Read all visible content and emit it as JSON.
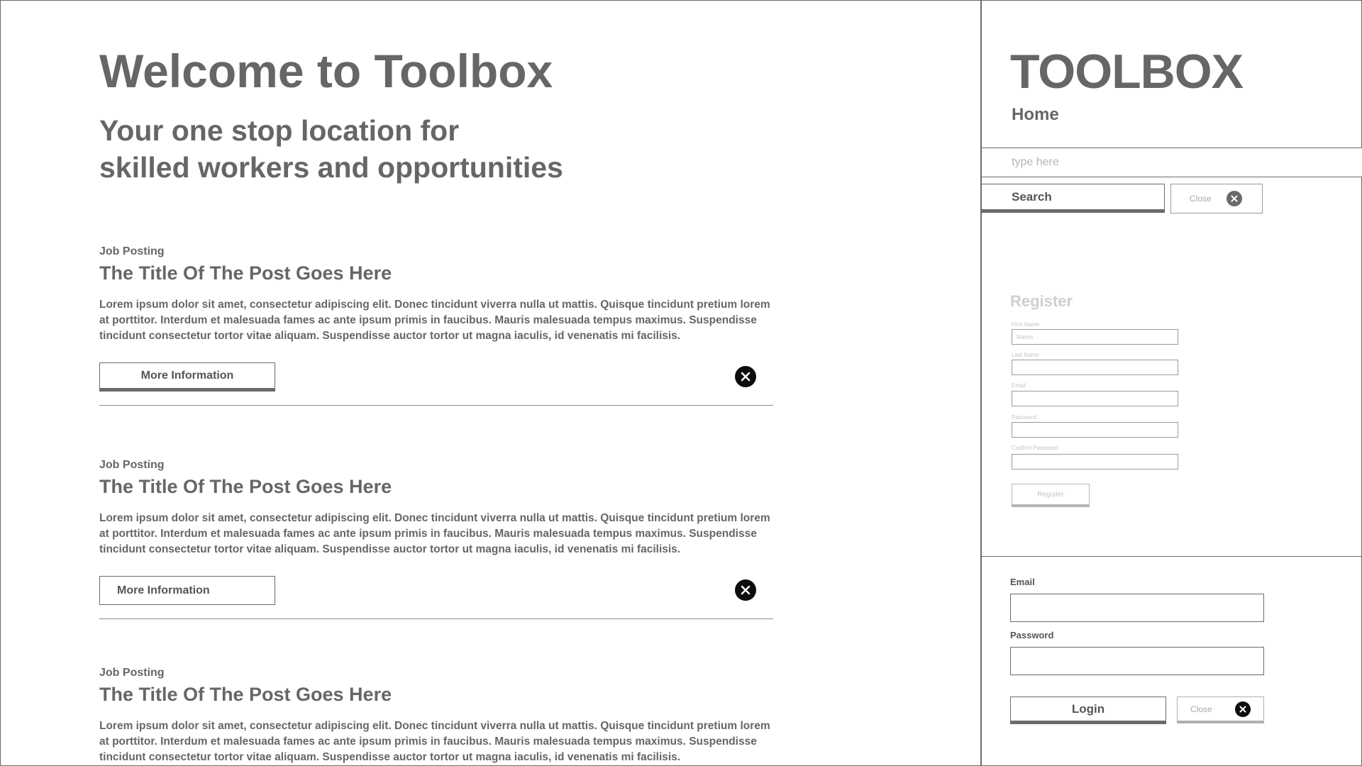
{
  "main": {
    "title": "Welcome to Toolbox",
    "subtitle_line1": "Your one stop location for",
    "subtitle_line2": "skilled workers and opportunities",
    "posts": [
      {
        "kicker": "Job Posting",
        "title": "The Title Of The Post Goes Here",
        "body": "Lorem ipsum dolor sit amet, consectetur adipiscing elit. Donec tincidunt viverra nulla ut mattis. Quisque tincidunt pretium lorem at porttitor. Interdum et malesuada fames ac ante ipsum primis in faucibus. Mauris malesuada tempus maximus. Suspendisse tincidunt consectetur tortor vitae aliquam. Suspendisse auctor tortor ut magna iaculis, id venenatis mi facilisis.",
        "button_label": "More Information"
      },
      {
        "kicker": "Job Posting",
        "title": "The Title Of The Post Goes Here",
        "body": "Lorem ipsum dolor sit amet, consectetur adipiscing elit. Donec tincidunt viverra nulla ut mattis. Quisque tincidunt pretium lorem at porttitor. Interdum et malesuada fames ac ante ipsum primis in faucibus. Mauris malesuada tempus maximus. Suspendisse tincidunt consectetur tortor vitae aliquam. Suspendisse auctor tortor ut magna iaculis, id venenatis mi facilisis.",
        "button_label": "More Information"
      },
      {
        "kicker": "Job Posting",
        "title": "The Title Of The Post Goes Here",
        "body": "Lorem ipsum dolor sit amet, consectetur adipiscing elit. Donec tincidunt viverra nulla ut mattis. Quisque tincidunt pretium lorem at porttitor. Interdum et malesuada fames ac ante ipsum primis in faucibus. Mauris malesuada tempus maximus. Suspendisse tincidunt consectetur tortor vitae aliquam. Suspendisse auctor tortor ut magna iaculis, id venenatis mi facilisis."
      }
    ],
    "icons": {
      "dismiss": "close-circle-icon"
    }
  },
  "sidebar": {
    "brand": "TOOLBOX",
    "nav_home": "Home",
    "search": {
      "placeholder": "type here",
      "search_label": "Search",
      "close_label": "Close"
    },
    "register": {
      "title": "Register",
      "first_name_label": "First Name",
      "first_name_placeholder": "Maxim",
      "last_name_label": "Last Name",
      "email_label": "Email",
      "password_label": "Password",
      "confirm_password_label": "Confirm Password",
      "button_label": "Register"
    },
    "login": {
      "email_label": "Email",
      "password_label": "Password",
      "login_label": "Login",
      "close_label": "Close"
    }
  },
  "colors": {
    "text": "#666666",
    "border": "#6b6b6b",
    "icon_dark": "#0d0d0d",
    "faded": "#c4c4c4"
  }
}
